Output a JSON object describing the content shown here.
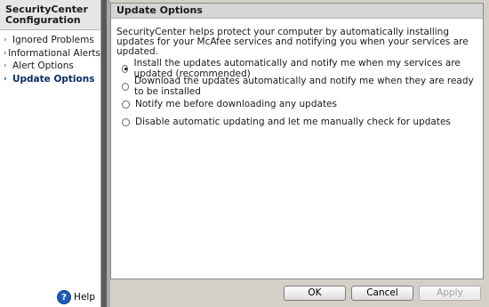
{
  "sidebar": {
    "title_line1": "SecurityCenter",
    "title_line2": "Configuration",
    "items": [
      {
        "label": "Ignored Problems",
        "active": false
      },
      {
        "label": "Informational Alerts",
        "active": false
      },
      {
        "label": "Alert Options",
        "active": false
      },
      {
        "label": "Update Options",
        "active": true
      }
    ],
    "help_label": "Help",
    "help_icon": "question-icon"
  },
  "panel": {
    "title": "Update Options",
    "description": "SecurityCenter helps protect your computer by automatically installing updates for your McAfee services and notifying you when your services are updated.",
    "options": [
      {
        "label": "Install the updates automatically and notify me when my services are updated (recommended)",
        "selected": true
      },
      {
        "label": "Download the updates automatically and notify me when they are ready to be installed",
        "selected": false
      },
      {
        "label": "Notify me before downloading any updates",
        "selected": false
      },
      {
        "label": "Disable automatic updating and let me manually check for updates",
        "selected": false
      }
    ]
  },
  "buttons": {
    "ok": "OK",
    "cancel": "Cancel",
    "apply": "Apply"
  },
  "colors": {
    "active_nav": "#0d2a66",
    "window_bg": "#d4d0c8",
    "divider": "#5a5a5a"
  }
}
